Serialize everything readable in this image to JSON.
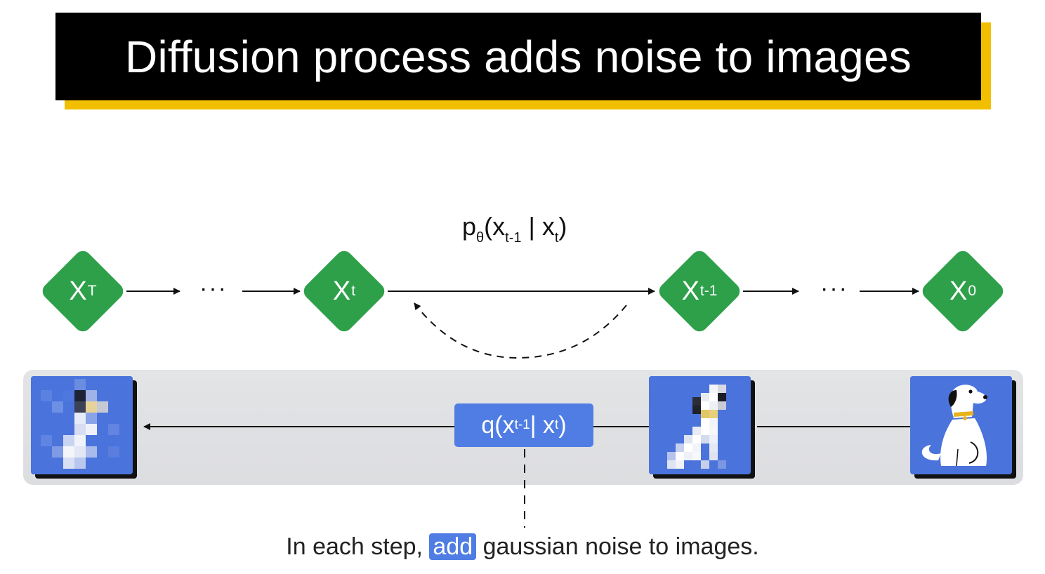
{
  "title": "Diffusion process adds noise to images",
  "nodes": [
    {
      "main": "X",
      "sub": "T"
    },
    {
      "main": "X",
      "sub": "t"
    },
    {
      "main": "X",
      "sub": "t-1"
    },
    {
      "main": "X",
      "sub": "0"
    }
  ],
  "ellipsis": "···",
  "reverse_formula": {
    "p": "p",
    "p_sub": "θ",
    "open": "(x",
    "sub1": "t-1",
    "mid": " | x",
    "sub2": "t",
    "close": ")"
  },
  "forward_formula": {
    "open": "q(x",
    "sub1": "t-1",
    "mid": " | x",
    "sub2": "t",
    "close": ")"
  },
  "caption": {
    "before": "In each step, ",
    "highlight": "add",
    "after": " gaussian noise to images."
  },
  "colors": {
    "node": "#2ea04a",
    "tile": "#4a73dc",
    "label_box": "#4f7de4",
    "title_bg": "#000000",
    "title_accent": "#f2be00"
  }
}
